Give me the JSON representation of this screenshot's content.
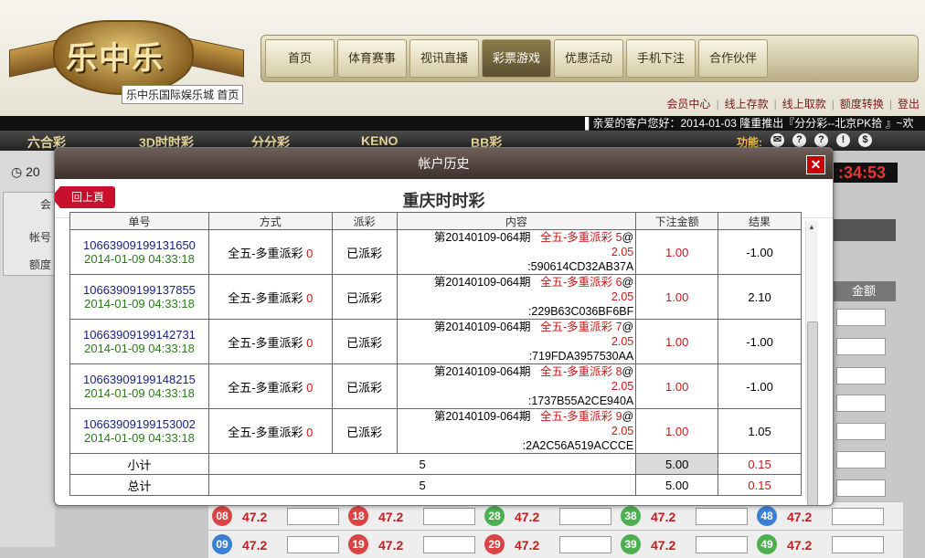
{
  "header": {
    "logo_text": "乐中乐",
    "tooltip": "乐中乐国际娱乐城 首页",
    "nav": [
      "首页",
      "体育赛事",
      "视讯直播",
      "彩票游戏",
      "优惠活动",
      "手机下注",
      "合作伙伴"
    ],
    "active_nav": "彩票游戏",
    "links": [
      "会员中心",
      "线上存款",
      "线上取款",
      "额度转换",
      "登出"
    ],
    "marquee": "▌亲爱的客户您好：2014-01-03 隆重推出『分分彩--北京PK拾 』~欢"
  },
  "game_bar": {
    "tabs": [
      "六合彩",
      "3D时时彩",
      "分分彩",
      "KENO",
      "BB彩"
    ],
    "func_label": "功能:",
    "func_icons": [
      "✉",
      "?",
      "?",
      "!",
      "$"
    ]
  },
  "background": {
    "clock": "20",
    "timer": ":34:53",
    "left_labels": [
      "会",
      "帐号",
      "额度"
    ],
    "amount_header": "金额",
    "balls": [
      {
        "num": "08",
        "odds": "47.2",
        "color": "#d94545"
      },
      {
        "num": "18",
        "odds": "47.2",
        "color": "#d94545"
      },
      {
        "num": "28",
        "odds": "47.2",
        "color": "#4caf50"
      },
      {
        "num": "38",
        "odds": "47.2",
        "color": "#4caf50"
      },
      {
        "num": "48",
        "odds": "47.2",
        "color": "#3b7fd4"
      },
      {
        "num": "09",
        "odds": "47.2",
        "color": "#3b7fd4"
      },
      {
        "num": "19",
        "odds": "47.2",
        "color": "#d94545"
      },
      {
        "num": "29",
        "odds": "47.2",
        "color": "#d94545"
      },
      {
        "num": "39",
        "odds": "47.2",
        "color": "#4caf50"
      },
      {
        "num": "49",
        "odds": "47.2",
        "color": "#4caf50"
      }
    ]
  },
  "modal": {
    "title": "帐户历史",
    "close": "✕",
    "subtitle": "重庆时时彩",
    "back": "回上頁",
    "columns": [
      "单号",
      "方式",
      "派彩",
      "内容",
      "下注金额",
      "结果"
    ],
    "rows": [
      {
        "order": "10663909199131650",
        "date": "2014-01-09 04:33:18",
        "method": "全五-多重派彩",
        "method_count": "0",
        "payout": "已派彩",
        "period": "第20140109-064期",
        "bet_type": "全五-多重派彩",
        "bet_num": "5",
        "at": "@",
        "odds": "2.05",
        "code": ":590614CD32AB37A",
        "amount": "1.00",
        "result": "-1.00"
      },
      {
        "order": "10663909199137855",
        "date": "2014-01-09 04:33:18",
        "method": "全五-多重派彩",
        "method_count": "0",
        "payout": "已派彩",
        "period": "第20140109-064期",
        "bet_type": "全五-多重派彩",
        "bet_num": "6",
        "at": "@",
        "odds": "2.05",
        "code": ":229B63C036BF6BF",
        "amount": "1.00",
        "result": "2.10"
      },
      {
        "order": "10663909199142731",
        "date": "2014-01-09 04:33:18",
        "method": "全五-多重派彩",
        "method_count": "0",
        "payout": "已派彩",
        "period": "第20140109-064期",
        "bet_type": "全五-多重派彩",
        "bet_num": "7",
        "at": "@",
        "odds": "2.05",
        "code": ":719FDA3957530AA",
        "amount": "1.00",
        "result": "-1.00"
      },
      {
        "order": "10663909199148215",
        "date": "2014-01-09 04:33:18",
        "method": "全五-多重派彩",
        "method_count": "0",
        "payout": "已派彩",
        "period": "第20140109-064期",
        "bet_type": "全五-多重派彩",
        "bet_num": "8",
        "at": "@",
        "odds": "2.05",
        "code": ":1737B55A2CE940A",
        "amount": "1.00",
        "result": "-1.00"
      },
      {
        "order": "10663909199153002",
        "date": "2014-01-09 04:33:18",
        "method": "全五-多重派彩",
        "method_count": "0",
        "payout": "已派彩",
        "period": "第20140109-064期",
        "bet_type": "全五-多重派彩",
        "bet_num": "9",
        "at": "@",
        "odds": "2.05",
        "code": ":2A2C56A519ACCCE",
        "amount": "1.00",
        "result": "1.05"
      }
    ],
    "subtotal": {
      "label": "小计",
      "count": "5",
      "amount": "5.00",
      "result": "0.15"
    },
    "total": {
      "label": "总计",
      "count": "5",
      "amount": "5.00",
      "result": "0.15"
    }
  }
}
